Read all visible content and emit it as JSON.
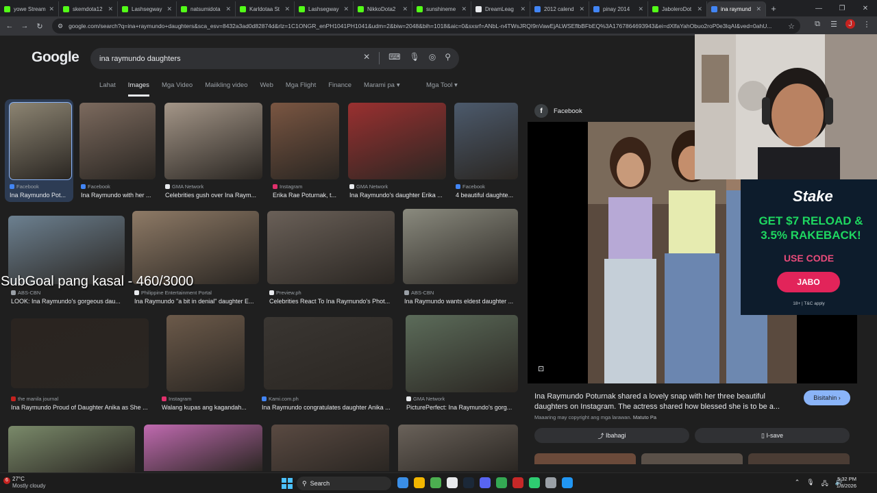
{
  "browser": {
    "tabs": [
      {
        "label": "yowe Stream",
        "color": "#53fc18"
      },
      {
        "label": "skemdota12",
        "color": "#53fc18"
      },
      {
        "label": "Lashsegway",
        "color": "#53fc18"
      },
      {
        "label": "natsumidota",
        "color": "#53fc18"
      },
      {
        "label": "Karldotaa St",
        "color": "#53fc18"
      },
      {
        "label": "Lashsegway",
        "color": "#53fc18"
      },
      {
        "label": "NikkoDota2",
        "color": "#53fc18"
      },
      {
        "label": "sunshineme",
        "color": "#53fc18"
      },
      {
        "label": "DreamLeag",
        "color": "#e8eaed"
      },
      {
        "label": "2012 calend",
        "color": "#4285f4"
      },
      {
        "label": "pinay 2014",
        "color": "#4285f4"
      },
      {
        "label": "JaboleroDot",
        "color": "#53fc18"
      },
      {
        "label": "ina raymund",
        "color": "#4285f4"
      }
    ],
    "new_tab": "+",
    "url": "google.com/search?q=ina+raymundo+daughters&sca_esv=8432a3ad0d82874d&rlz=1C1ONGR_enPH1041PH1041&udm=2&biw=2048&bih=1018&aic=0&sxsrf=ANbL-n4TWsJRQI9nVawEjALWSEflbBFbEQ%3A1767864693943&ei=dXlfaYahObuo2roP0e3IqAI&ved=0ahU..."
  },
  "google": {
    "logo": "Google",
    "query": "ina raymundo daughters",
    "tabs": [
      "Lahat",
      "Images",
      "Mga Video",
      "Maiikling video",
      "Web",
      "Mga Flight",
      "Finance",
      "Marami pa"
    ],
    "tools": "Mga Tool"
  },
  "results": [
    {
      "source": "Facebook",
      "caption": "Ina Raymundo Pot...",
      "icolor": "#4285f4"
    },
    {
      "source": "Facebook",
      "caption": "Ina Raymundo with her ...",
      "icolor": "#4285f4"
    },
    {
      "source": "GMA Network",
      "caption": "Celebrities gush over Ina Raym...",
      "icolor": "#e8eaed"
    },
    {
      "source": "Instagram",
      "caption": "Erika Rae Poturnak, t...",
      "icolor": "#e1306c"
    },
    {
      "source": "GMA Network",
      "caption": "Ina Raymundo's daughter Erika ...",
      "icolor": "#e8eaed"
    },
    {
      "source": "Facebook",
      "caption": "4 beautiful daughte...",
      "icolor": "#4285f4"
    },
    {
      "source": "ABS-CBN",
      "caption": "LOOK: Ina Raymundo's gorgeous dau...",
      "icolor": "#9aa0a6"
    },
    {
      "source": "Philippine Entertainment Portal",
      "caption": "Ina Raymundo \"a bit in denial\" daughter E...",
      "icolor": "#e8eaed"
    },
    {
      "source": "Preview.ph",
      "caption": "Celebrities React To Ina Raymundo's Phot...",
      "icolor": "#e8eaed"
    },
    {
      "source": "ABS-CBN",
      "caption": "Ina Raymundo wants eldest daughter ...",
      "icolor": "#9aa0a6"
    },
    {
      "source": "the manila journal",
      "caption": "Ina Raymundo Proud of Daughter Anika as She ...",
      "icolor": "#c5221f"
    },
    {
      "source": "Instagram",
      "caption": "Walang kupas ang kagandah...",
      "icolor": "#e1306c"
    },
    {
      "source": "Kami.com.ph",
      "caption": "Ina Raymundo congratulates daughter Anika ...",
      "icolor": "#4285f4"
    },
    {
      "source": "GMA Network",
      "caption": "PicturePerfect: Ina Raymundo's gorg...",
      "icolor": "#e8eaed"
    }
  ],
  "overlay": "SubGoal pang kasal - 460/3000",
  "panel": {
    "source": "Facebook",
    "title": "Ina Raymundo Poturnak shared a lovely snap with her three beautiful daughters on Instagram. The actress shared how blessed she is to be a...",
    "visit": "Bisitahin",
    "copyright": "Maaaring may copyright ang mga larawan.",
    "learn_more": "Matuto Pa",
    "share": "Ibahagi",
    "save": "I-save"
  },
  "ad": {
    "brand": "Stake",
    "headline": "GET $7 RELOAD & 3.5% RAKEBACK!",
    "use_code": "USE CODE",
    "code": "JABO",
    "terms": "18+ | T&C apply"
  },
  "taskbar": {
    "temp": "27°C",
    "weather": "Mostly cloudy",
    "weather_badge": "6",
    "search": "Search",
    "time": "5:32 PM",
    "date": "1/8/2026"
  }
}
